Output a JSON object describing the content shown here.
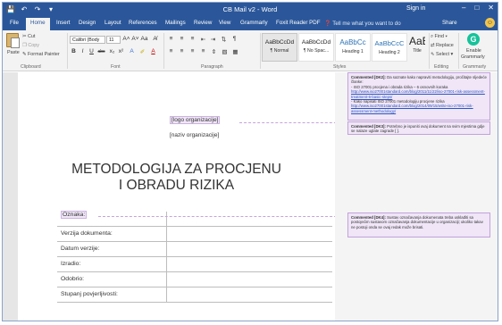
{
  "titlebar": {
    "title": "CB Mail v2  -  Word",
    "sign_in": "Sign in",
    "qat": [
      "💾",
      "↶",
      "↷",
      "▾"
    ],
    "controls": [
      "–",
      "□",
      "✕"
    ]
  },
  "tabs": [
    "File",
    "Home",
    "Insert",
    "Design",
    "Layout",
    "References",
    "Mailings",
    "Review",
    "View",
    "Grammarly",
    "Foxit Reader PDF"
  ],
  "tell_me": "❓ Tell me what you want to do",
  "share": "Share",
  "ribbon": {
    "clipboard": {
      "paste": "Paste",
      "cut": "✂ Cut",
      "copy": "❐ Copy",
      "format_painter": "✎ Format Painter",
      "label": "Clipboard"
    },
    "font": {
      "name": "Calibri (Body",
      "size": "11",
      "row1_buttons": [
        "A˄",
        "A˅",
        "Aa",
        "A̸"
      ],
      "row2_buttons": [
        "B",
        "I",
        "U",
        "abc",
        "x₂",
        "x²",
        "A",
        "✐",
        "A"
      ],
      "label": "Font"
    },
    "paragraph": {
      "row1_buttons": [
        "≡",
        "≡",
        "≡",
        "⇤",
        "⇥",
        "⇅",
        "¶"
      ],
      "row2_buttons": [
        "≡",
        "≡",
        "≡",
        "≡",
        "⇕",
        "▧",
        "▦"
      ],
      "label": "Paragraph"
    },
    "styles": {
      "items": [
        {
          "sample": "AaBbCcDd",
          "name": "¶ Normal"
        },
        {
          "sample": "AaBbCcDd",
          "name": "¶ No Spac..."
        },
        {
          "sample": "AaBbCc",
          "name": "Heading 1"
        },
        {
          "sample": "AaBbCcC",
          "name": "Heading 2"
        },
        {
          "sample": "AaB",
          "name": "Title"
        }
      ],
      "label": "Styles"
    },
    "editing": {
      "find": "⌕ Find ▾",
      "replace": "⇄ Replace",
      "select": "⇖ Select ▾",
      "label": "Editing"
    },
    "grammarly": {
      "enable": "Enable",
      "name": "Grammarly",
      "label": "Grammarly"
    }
  },
  "document": {
    "logo_placeholder": "[logo organizacije]",
    "org_name": "[naziv organizacije]",
    "title_line1": "METODOLOGIJA ZA PROCJENU",
    "title_line2": "I OBRADU RIZIKA",
    "oznaka": "Oznaka:",
    "meta_rows": [
      "",
      "Verzija dokumenta:",
      "Datum verzije:",
      "Izradio:",
      "Odobrio:",
      "Stupanj povjerljivosti:"
    ]
  },
  "comments": [
    {
      "head": "Commented [DK2]:",
      "body": "Da saznate kako napraviti metodologiju, pročitajte sljedeće članke:",
      "bullet1": "- ISO 27001 procjena i obrada rizika – 6 osnovnih koraka",
      "link1": "http://www.iso27001standard.com/blog/2011/11/22/iso-27001-risk-assessment-treatment-6-basic-steps/",
      "bullet2": "- Kako napisati ISO 27001 metodologiju procjene rizika",
      "link2": "http://www.iso27001standard.com/blog/2014/09/15/write-iso-27001-risk-assessment-methodology/"
    },
    {
      "head": "Commented [DK3]:",
      "body": "Potrebno je ispuniti ovaj dokument na svim mjestima gdje se nalaze uglate zagrade [ ]."
    },
    {
      "head": "Commented [DK4]:",
      "body": "Sustav označavanja dokumenata treba usklađiti sa postojećim sustavom označavanja dokumentacije u organizaciji; ukoliko takav ne postoji onda se ovaj redak može brisati."
    }
  ]
}
